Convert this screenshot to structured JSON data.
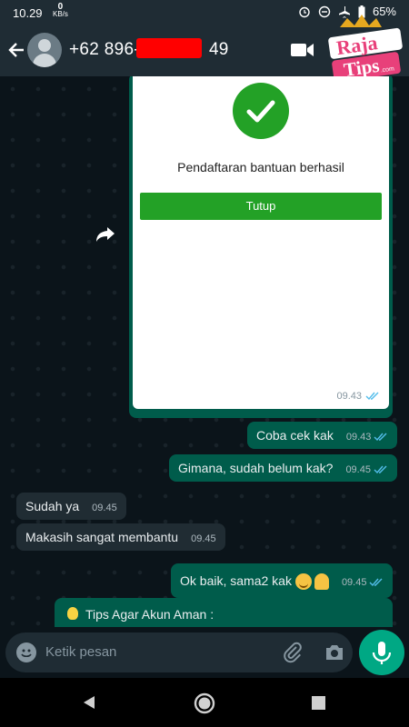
{
  "status": {
    "time": "10.29",
    "speed_value": "0",
    "speed_unit": "KB/s",
    "battery": "65%"
  },
  "header": {
    "contact_prefix": "+62 896-",
    "contact_suffix": "49",
    "logo_line1": "Raja",
    "logo_line2": "Tips",
    "logo_suffix": ".com"
  },
  "image_message": {
    "success_text": "Pendaftaran bantuan berhasil",
    "button_label": "Tutup",
    "time": "09.43"
  },
  "messages": [
    {
      "text": "Coba cek kak",
      "time": "09.43",
      "direction": "out"
    },
    {
      "text": "Gimana, sudah belum kak?",
      "time": "09.45",
      "direction": "out"
    },
    {
      "text": "Sudah ya",
      "time": "09.45",
      "direction": "in"
    },
    {
      "text": "Makasih sangat membantu",
      "time": "09.45",
      "direction": "in"
    },
    {
      "text": "Ok baik, sama2 kak",
      "time": "09.45",
      "direction": "out"
    }
  ],
  "tips_message": {
    "text": "Tips Agar Akun Aman :"
  },
  "input": {
    "placeholder": "Ketik pesan"
  },
  "colors": {
    "outgoing": "#005c4b",
    "incoming": "#202c33",
    "accent": "#00a884",
    "success": "#23a126"
  }
}
